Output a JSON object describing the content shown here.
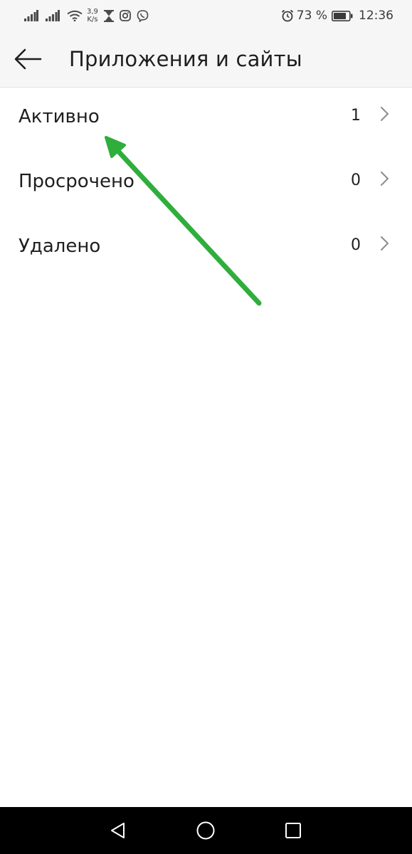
{
  "status_bar": {
    "speed_value": "3,9",
    "speed_unit": "K/s",
    "battery_percent": "73 %",
    "time": "12:36",
    "icons": [
      "signal-icon",
      "signal-icon",
      "wifi-icon",
      "hourglass-icon",
      "instagram-icon",
      "viber-icon",
      "alarm-icon",
      "battery-icon"
    ]
  },
  "toolbar": {
    "title": "Приложения и сайты",
    "back_icon": "back-arrow-icon"
  },
  "list": {
    "items": [
      {
        "label": "Активно",
        "count": "1"
      },
      {
        "label": "Просрочено",
        "count": "0"
      },
      {
        "label": "Удалено",
        "count": "0"
      }
    ]
  },
  "annotation": {
    "color": "#2fae3b",
    "points_to": "Активно"
  },
  "nav_bar": {
    "buttons": [
      "back-triangle-icon",
      "home-circle-icon",
      "recents-square-icon"
    ]
  }
}
